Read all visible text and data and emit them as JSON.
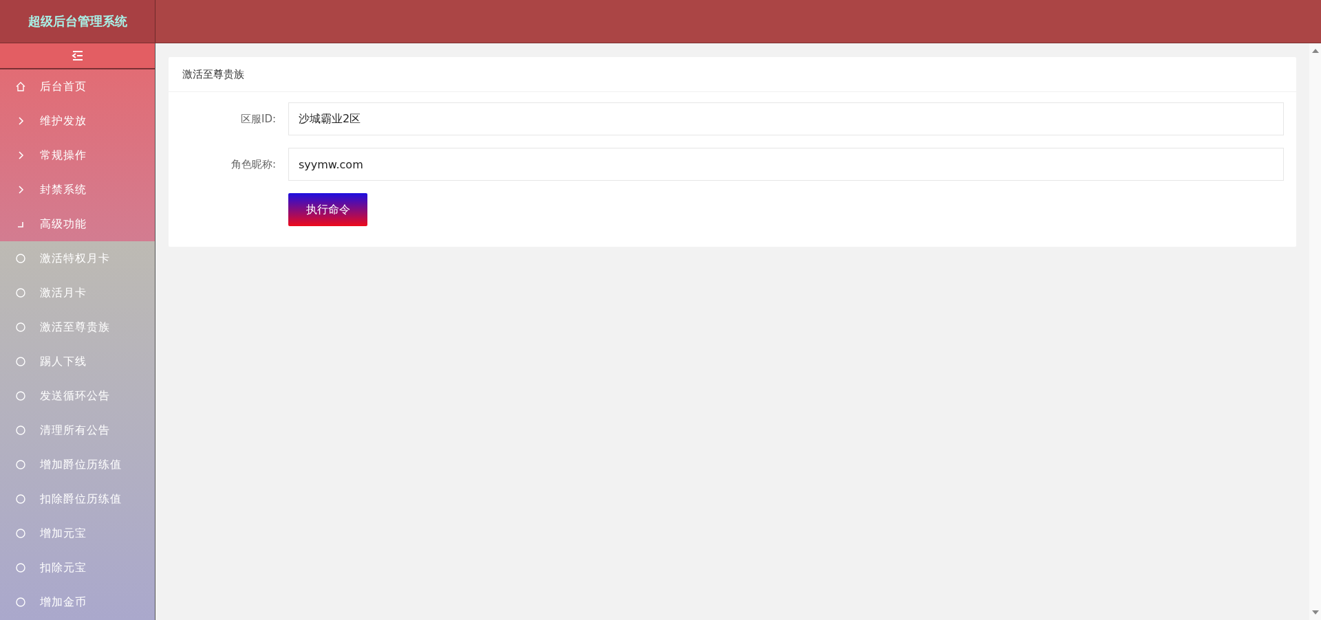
{
  "header": {
    "title": "超级后台管理系统"
  },
  "sidebar": {
    "items": [
      {
        "label": "后台首页",
        "kind": "link"
      },
      {
        "label": "维护发放",
        "kind": "group",
        "expanded": false
      },
      {
        "label": "常规操作",
        "kind": "group",
        "expanded": false
      },
      {
        "label": "封禁系统",
        "kind": "group",
        "expanded": false
      },
      {
        "label": "高级功能",
        "kind": "group",
        "expanded": true,
        "children": [
          {
            "label": "激活特权月卡"
          },
          {
            "label": "激活月卡"
          },
          {
            "label": "激活至尊贵族"
          },
          {
            "label": "踢人下线"
          },
          {
            "label": "发送循环公告"
          },
          {
            "label": "清理所有公告"
          },
          {
            "label": "增加爵位历练值"
          },
          {
            "label": "扣除爵位历练值"
          },
          {
            "label": "增加元宝"
          },
          {
            "label": "扣除元宝"
          },
          {
            "label": "增加金币"
          }
        ]
      }
    ]
  },
  "panel": {
    "title": "激活至尊贵族",
    "fields": [
      {
        "label": "区服ID:",
        "value": "沙城霸业2区"
      },
      {
        "label": "角色昵称:",
        "value": "syymw.com"
      }
    ],
    "button": "执行命令"
  }
}
